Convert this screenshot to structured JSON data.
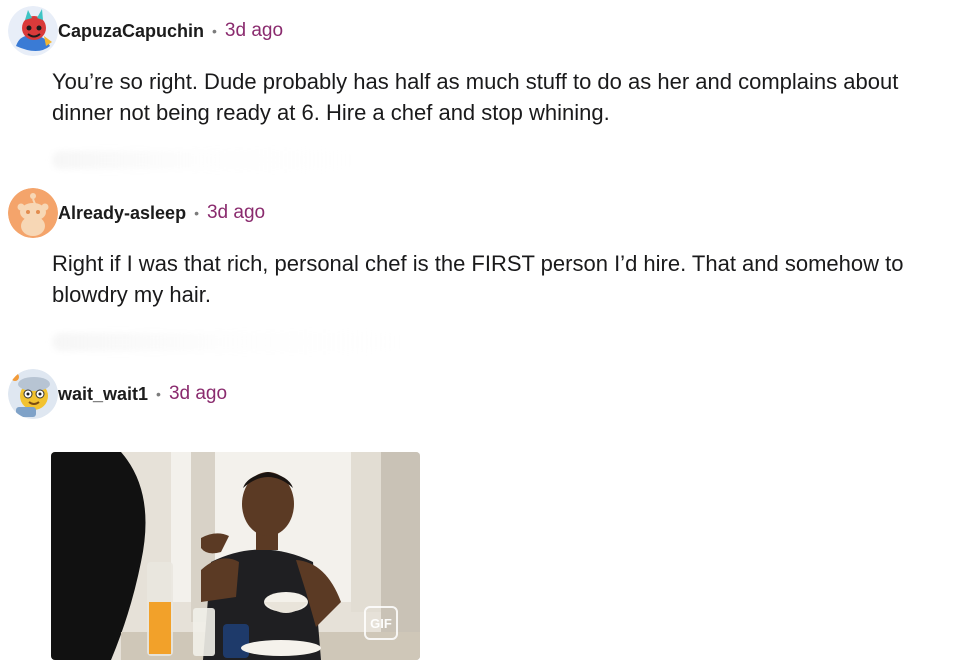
{
  "comments": [
    {
      "username": "CapuzaCapuchin",
      "separator": "•",
      "time": "3d ago",
      "text": "You’re so right. Dude probably has half as much stuff to do as her and complains about dinner not being ready at 6. Hire a chef and stop whining."
    },
    {
      "username": "Already-asleep",
      "separator": "•",
      "time": "3d ago",
      "text": "Right if I was that rich, personal chef is the FIRST person I’d hire. That and somehow to blowdry my hair."
    },
    {
      "username": "wait_wait1",
      "separator": "•",
      "time": "3d ago",
      "gif": {
        "badge": "GIF"
      }
    }
  ],
  "colors": {
    "username": "#1c1c1c",
    "time": "#8a2b6e",
    "body": "#1a1a1b",
    "avatar_orange": "#f4a46b"
  }
}
